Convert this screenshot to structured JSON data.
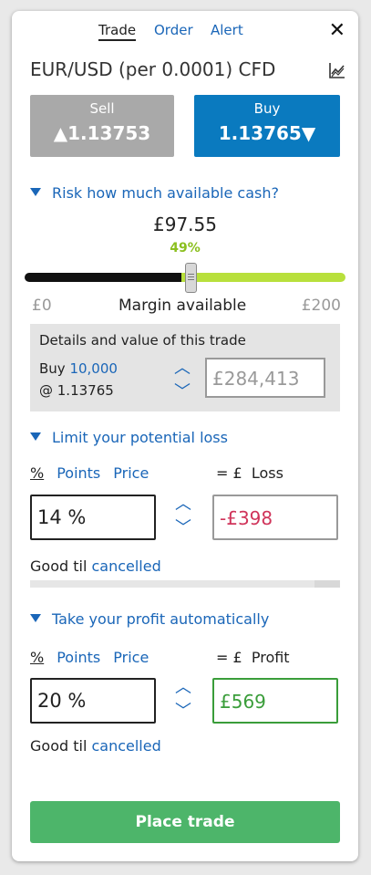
{
  "tabs": {
    "trade": "Trade",
    "order": "Order",
    "alert": "Alert"
  },
  "close_label": "✕",
  "instrument": {
    "title": "EUR/USD (per 0.0001) CFD"
  },
  "sell": {
    "label": "Sell",
    "price": "▲1.13753"
  },
  "buy": {
    "label": "Buy",
    "price": "1.13765▼"
  },
  "risk": {
    "heading": "Risk how much available cash?",
    "amount": "£97.55",
    "percent": "49%",
    "slider_fraction": 0.49,
    "min_label": "£0",
    "mid_label": "Margin available",
    "max_label": "£200"
  },
  "details": {
    "heading": "Details and value of this trade",
    "buy_prefix": "Buy ",
    "quantity": "10,000",
    "at_price": "@ 1.13765",
    "value": "£284,413"
  },
  "loss": {
    "heading": "Limit your potential loss",
    "mode_percent": "%",
    "mode_points": "Points",
    "mode_price": "Price",
    "eq_label": "= £",
    "result_label": "Loss",
    "input_value": "14 %",
    "result_value": "-£398",
    "gtc_prefix": "Good til ",
    "gtc_value": "cancelled"
  },
  "profit": {
    "heading": "Take your profit automatically",
    "mode_percent": "%",
    "mode_points": "Points",
    "mode_price": "Price",
    "eq_label": "= £",
    "result_label": "Profit",
    "input_value": "20 %",
    "result_value": "£569",
    "gtc_prefix": "Good til ",
    "gtc_value": "cancelled"
  },
  "place_trade": "Place trade",
  "colors": {
    "accent": "#1a66b8",
    "buy": "#0a7abf",
    "sell": "#a9a9a9",
    "place": "#4db56a",
    "loss": "#d0345a",
    "profit": "#3a9d3a",
    "slider_fill": "#b8e03c"
  }
}
